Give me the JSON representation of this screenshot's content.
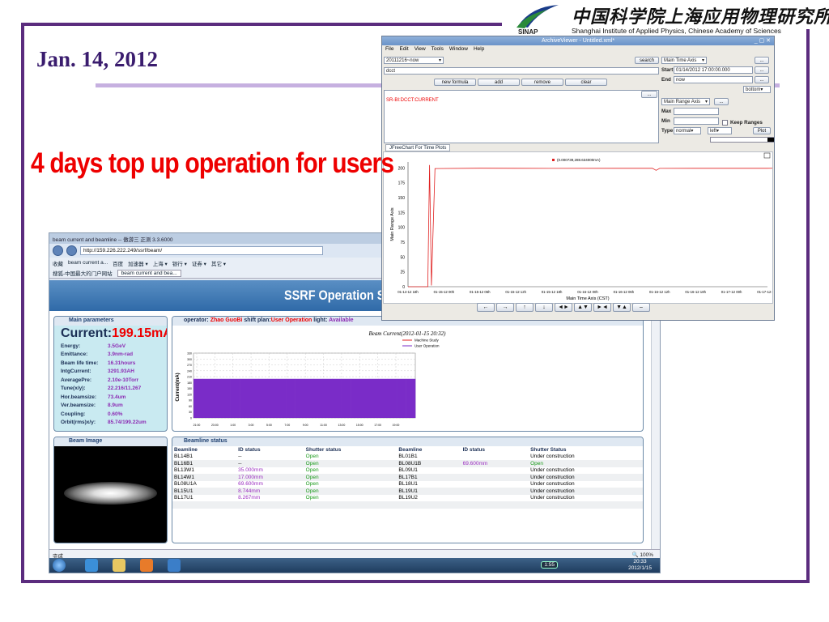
{
  "slide": {
    "date": "Jan. 14, 2012",
    "headline": "4 days top up operation for users",
    "logo_cn": "中国科学院上海应用物理研究所",
    "logo_en": "Shanghai Institute of Applied Physics, Chinese Academy of Sciences",
    "logo_abbr": "SINAP"
  },
  "browser": {
    "tab_title": "beam current and beamline -- 傲游三 正测 3.3.6000",
    "url": "http://159.226.222.249/ssrf/beam/",
    "favorites": [
      "收藏",
      "beam current a...",
      "百度",
      "加速器 ▾",
      "上海 ▾",
      "银行 ▾",
      "证券 ▾",
      "其它 ▾"
    ],
    "favorites2": [
      "搜狐-中国最大的门户网站",
      "beam current and bea..."
    ],
    "page_title": "SSRF Operation S",
    "status_left": "完成",
    "zoom": "100%",
    "clock_time": "20:33",
    "clock_date": "2012/1/15",
    "tray_time": "1:55"
  },
  "params": {
    "header": "Main parameters",
    "current_label": "Current:",
    "current_value": "199.15mA",
    "rows": [
      {
        "k": "Energy:",
        "v": "3.5GeV"
      },
      {
        "k": "Emittance:",
        "v": "3.9nm-rad"
      },
      {
        "k": "Beam life time:",
        "v": "16.31hours"
      },
      {
        "k": "IntgCurrent:",
        "v": "3291.93AH"
      },
      {
        "k": "AveragePre:",
        "v": "2.10e-10Torr"
      },
      {
        "k": "Tune(x/y):",
        "v": "22.216/11.267"
      },
      {
        "k": "Hor.beamsize:",
        "v": "73.4um"
      },
      {
        "k": "Ver.beamsize:",
        "v": "8.9um"
      },
      {
        "k": "Coupling:",
        "v": "0.60%"
      },
      {
        "k": "Orbit(rms)x/y:",
        "v": "85.74/199.22um"
      }
    ]
  },
  "ops": {
    "operator_label": "operator:",
    "operator": "Zhao GuoBi",
    "shift_label": "shift plan:",
    "shift": "User Operation",
    "light_label": "light:",
    "light": "Available"
  },
  "beam_image_header": "Beam Image",
  "beamline": {
    "header": "Beamline status",
    "columns": [
      "Beamline",
      "ID status",
      "Shutter status",
      "Beamline",
      "ID status",
      "Shutter Status"
    ],
    "rows": [
      [
        "BL14B1",
        "--",
        "Open",
        "BL01B1",
        "",
        "Under construction"
      ],
      [
        "BL16B1",
        "--",
        "Open",
        "BL08U1B",
        "69.600mm",
        "Open"
      ],
      [
        "BL13W1",
        "35.000mm",
        "Open",
        "BL09U1",
        "",
        "Under construction"
      ],
      [
        "BL14W1",
        "17.000mm",
        "Open",
        "BL17B1",
        "",
        "Under construction"
      ],
      [
        "BL08U1A",
        "69.600mm",
        "Open",
        "BL18U1",
        "",
        "Under construction"
      ],
      [
        "BL15U1",
        "8.744mm",
        "Open",
        "BL19U1",
        "",
        "Under construction"
      ],
      [
        "BL17U1",
        "8.267mm",
        "Open",
        "BL19U2",
        "",
        "Under construction"
      ]
    ]
  },
  "archive_viewer": {
    "title": "ArchiveViewer - Untitled.xml*",
    "menu": [
      "File",
      "Edit",
      "View",
      "Tools",
      "Window",
      "Help"
    ],
    "archive_select": "20111216~now",
    "search_btn": "search",
    "filter_field": "dcct",
    "buttons": [
      "new formula",
      "add",
      "remove",
      "clear"
    ],
    "pv_name": "SR-BI:DCCT:CURRENT",
    "time_axis_label": "Main Time Axis",
    "start_label": "Start",
    "start_value": "01/14/2012 17:00:00.000",
    "end_label": "End",
    "end_value": "now",
    "bottom_select": "bottom",
    "range_axis_label": "Main Range Axis",
    "max_label": "Max",
    "min_label": "Min",
    "keep_ranges": "Keep Ranges",
    "type_label": "Type",
    "type_value": "normal",
    "side_value": "left",
    "plot_btn": "Plot",
    "chart_tab": "JFreeChart For Time Plots",
    "legend": "(0.000739,288.634000mA)",
    "ylabel": "Main Range Axis",
    "xlabel": "Main Time Axis (CST)",
    "nav": [
      "←",
      "→",
      "↑",
      "↓",
      "◄►",
      "▲▼",
      "►◄",
      "▼▲",
      "–"
    ]
  },
  "chart_data": [
    {
      "type": "line",
      "title": "",
      "xlabel": "Main Time Axis (CST)",
      "ylabel": "Main Range Axis",
      "x_ticks": [
        "01-14-12 18h",
        "01-15-12 00h",
        "01-15-12 06h",
        "01-15-12 12h",
        "01-15-12 18h",
        "01-16-12 00h",
        "01-16-12 06h",
        "01-16-12 12h",
        "01-16-12 18h",
        "01-17-12 00h",
        "01-17-12 06h"
      ],
      "y_ticks": [
        0,
        25,
        50,
        75,
        100,
        125,
        150,
        175,
        200
      ],
      "ylim": [
        0,
        210
      ],
      "series": [
        {
          "name": "",
          "color": "#e02020",
          "x": [
            0,
            0.55,
            0.6,
            0.65,
            0.75,
            2,
            4,
            6,
            6.8,
            6.9,
            7.0,
            8,
            9,
            10,
            11,
            11.2
          ],
          "y": [
            0,
            0,
            205,
            2,
            199,
            199.5,
            199.2,
            199.4,
            199.3,
            196,
            199.2,
            199.3,
            199.4,
            199.3,
            199.5,
            199.2
          ]
        }
      ]
    },
    {
      "type": "area",
      "title": "Beam Current(2012-01-15 20:32)",
      "ylabel": "Current(mA)",
      "x_ticks": [
        "21:00",
        "23:00",
        "1:00",
        "3:00",
        "5:00",
        "7:00",
        "9:00",
        "11:00",
        "13:00",
        "15:00",
        "17:00",
        "19:00"
      ],
      "y_ticks": [
        0,
        30,
        60,
        90,
        120,
        150,
        180,
        210,
        240,
        270,
        300,
        330
      ],
      "ylim": [
        0,
        330
      ],
      "series": [
        {
          "name": "Machine Study",
          "color": "#e02020",
          "values": []
        },
        {
          "name": "User Operation",
          "color": "#7a2cc8",
          "values": [
            199,
            199,
            199,
            199,
            199,
            199,
            199,
            199,
            199,
            199,
            199,
            199,
            199,
            199,
            199,
            199,
            199,
            199,
            199,
            199,
            199,
            199,
            199,
            199
          ]
        }
      ]
    }
  ]
}
